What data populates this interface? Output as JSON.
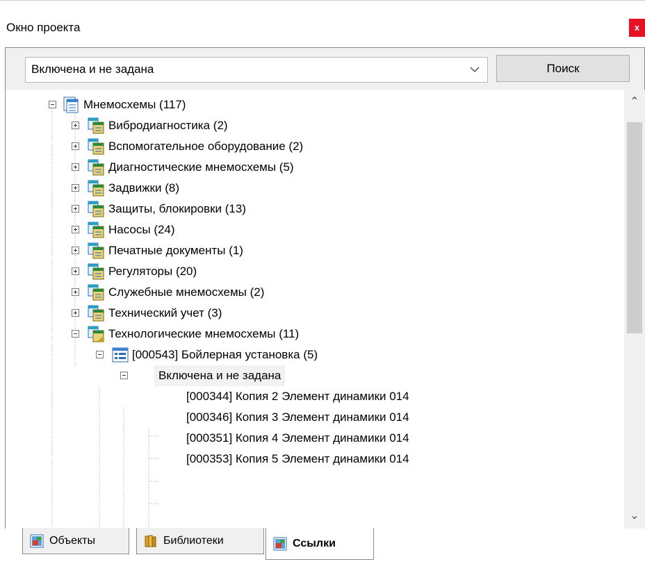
{
  "window": {
    "title": "Окно проекта",
    "close_label": "x"
  },
  "filter": {
    "selected": "Включена и не задана",
    "search_label": "Поиск"
  },
  "tree": {
    "root": "Мнемосхемы (117)",
    "groups": [
      "Вибродиагностика (2)",
      "Вспомогательное оборудование (2)",
      "Диагностические мнемосхемы (5)",
      "Задвижки (8)",
      "Защиты, блокировки (13)",
      "Насосы (24)",
      "Печатные документы (1)",
      "Регуляторы (20)",
      "Служебные мнемосхемы (2)",
      "Технический учет (3)",
      "Технологические мнемосхемы (11)"
    ],
    "screen": "[000543] Бойлерная установка (5)",
    "state": "Включена и не задана",
    "items": [
      "[000344] Копия 2 Элемент динамики 014",
      "[000346] Копия 3 Элемент динамики 014",
      "[000351] Копия 4 Элемент динамики 014",
      "[000353] Копия 5 Элемент динамики 014"
    ]
  },
  "tabs": [
    {
      "label": "Объекты",
      "icon": "objects-icon"
    },
    {
      "label": "Библиотеки",
      "icon": "library-icon"
    },
    {
      "label": "Ссылки",
      "icon": "links-icon",
      "active": true
    }
  ],
  "colors": {
    "close_bg": "#e81123",
    "scroll_thumb": "#cdcdcd"
  }
}
